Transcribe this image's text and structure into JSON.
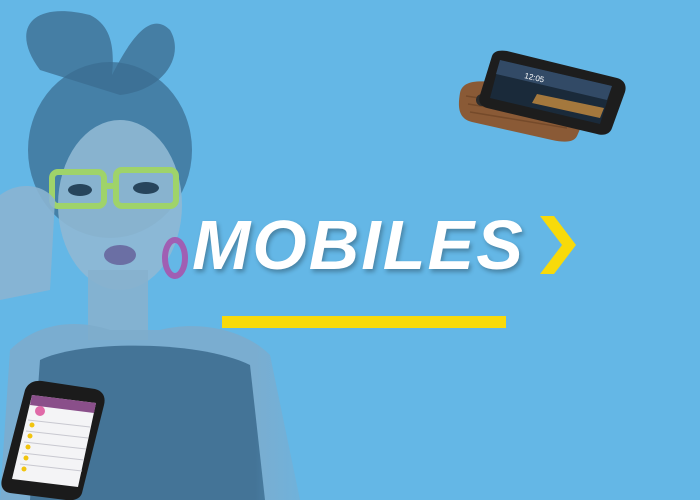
{
  "banner": {
    "title": "MOBILES",
    "accent_color": "#f8da0a",
    "background_color": "#64b7e6",
    "text_color": "#ffffff",
    "arrow_icon": "chevron-right-icon"
  },
  "images": {
    "model": "woman-with-glasses-photo",
    "phone_top": "smartphone-wood-back-photo",
    "phone_bottom": "smartphone-app-screen-photo"
  }
}
